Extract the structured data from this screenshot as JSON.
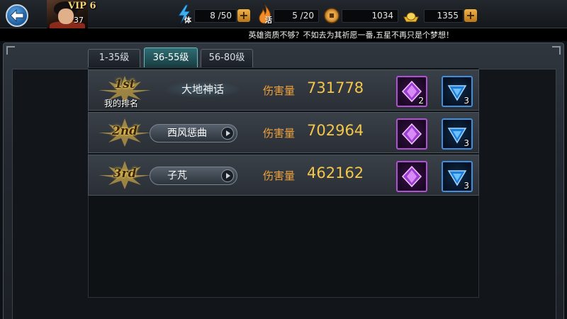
{
  "header": {
    "vip_label": "VIP 6",
    "player_level": "37",
    "stamina": {
      "tag": "体",
      "value": "8 /50"
    },
    "vitality": {
      "tag": "活",
      "value": "5 /20"
    },
    "coins": {
      "value": "1034"
    },
    "gold": {
      "value": "1355"
    },
    "plus_label": "+"
  },
  "notice": "英雄资质不够？不如去为其祈愿一番,五星不再只是个梦想！",
  "tabs": [
    {
      "label": "1-35级",
      "active": false
    },
    {
      "label": "36-55级",
      "active": true
    },
    {
      "label": "56-80级",
      "active": false
    }
  ],
  "rankings": [
    {
      "rank": "1st",
      "sub_label": "我的排名",
      "name": "大地神话",
      "damage_label": "伤害量",
      "damage": "731778",
      "purple_count": "2",
      "blue_count": "3"
    },
    {
      "rank": "2nd",
      "name": "西风惩曲",
      "damage_label": "伤害量",
      "damage": "702964",
      "purple_count": "",
      "blue_count": "3"
    },
    {
      "rank": "3rd",
      "name": "子芃",
      "damage_label": "伤害量",
      "damage": "462162",
      "purple_count": "",
      "blue_count": "3"
    }
  ],
  "colors": {
    "accent_gold": "#f4c64a",
    "damage_label": "#f0a23a",
    "active_tab": "#2f6f74",
    "purple_item": "#b34fd6",
    "blue_item": "#3f8fe0"
  },
  "icons": {
    "back": "back-arrow-icon",
    "stamina": "lightning-icon",
    "vitality": "flame-icon",
    "coins": "coin-icon",
    "gold": "gold-ingot-icon",
    "purple_item": "purple-crystal-icon",
    "blue_item": "blue-gem-icon"
  }
}
